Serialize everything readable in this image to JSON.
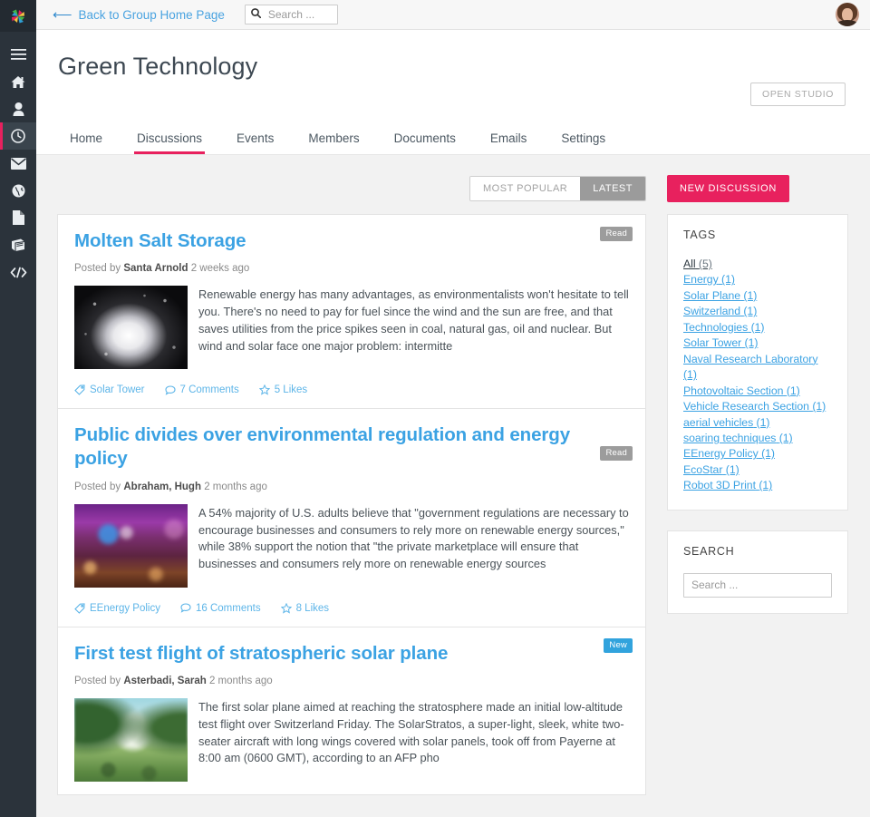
{
  "rail": {
    "logo_name": "pinwheel-logo",
    "items": [
      {
        "icon": "hamburger-menu-icon",
        "name": "menu"
      },
      {
        "icon": "home-icon",
        "name": "home"
      },
      {
        "icon": "person-icon",
        "name": "profile"
      },
      {
        "icon": "clock-icon",
        "name": "activity",
        "active": true
      },
      {
        "icon": "envelope-icon",
        "name": "messages"
      },
      {
        "icon": "globe-icon",
        "name": "network"
      },
      {
        "icon": "document-icon",
        "name": "documents"
      },
      {
        "icon": "book-icon",
        "name": "library"
      },
      {
        "icon": "code-icon",
        "name": "code"
      }
    ]
  },
  "topbar": {
    "back_label": "Back to Group Home Page",
    "search_placeholder": "Search ...",
    "search_value": ""
  },
  "header": {
    "title": "Green Technology",
    "open_studio_label": "OPEN STUDIO"
  },
  "tabs": [
    {
      "label": "Home",
      "active": false
    },
    {
      "label": "Discussions",
      "active": true
    },
    {
      "label": "Events",
      "active": false
    },
    {
      "label": "Members",
      "active": false
    },
    {
      "label": "Documents",
      "active": false
    },
    {
      "label": "Emails",
      "active": false
    },
    {
      "label": "Settings",
      "active": false
    }
  ],
  "filters": {
    "most_popular": "MOST POPULAR",
    "latest": "LATEST",
    "active": "LATEST",
    "new_discussion": "NEW DISCUSSION"
  },
  "posts": [
    {
      "title": "Molten Salt Storage",
      "badge": "Read",
      "badge_type": "read",
      "posted_by_prefix": "Posted by",
      "author": "Santa Arnold",
      "time": "2 weeks ago",
      "excerpt": "Renewable energy has many advantages, as environmentalists won't hesitate to tell you. There's no need to pay for fuel since the wind and the sun are free, and that saves utilities from the price spikes seen in coal, natural gas, oil and nuclear. But wind and solar face one major problem: intermitte",
      "tag": "Solar Tower",
      "comments": "7 Comments",
      "likes": "5 Likes",
      "thumb": "art-salt"
    },
    {
      "title": "Public divides over environmental regulation and energy policy",
      "badge": "Read",
      "badge_type": "read",
      "posted_by_prefix": "Posted by",
      "author": "Abraham, Hugh",
      "time": "2 months ago",
      "excerpt": "A 54% majority of U.S. adults believe that \"government regulations are necessary to encourage businesses and consumers to rely more on renewable energy sources,\" while 38% support the notion that \"the private marketplace will ensure that businesses and consumers rely more on renewable energy sources",
      "tag": "EEnergy Policy",
      "comments": "16 Comments",
      "likes": "8 Likes",
      "thumb": "art-gala"
    },
    {
      "title": "First test flight of stratospheric solar plane",
      "badge": "New",
      "badge_type": "new",
      "posted_by_prefix": "Posted by",
      "author": "Asterbadi, Sarah",
      "time": "2 months ago",
      "excerpt": "The first solar plane aimed at reaching the stratosphere made an initial low-altitude test flight over Switzerland Friday. The SolarStratos, a super-light, sleek, white two-seater aircraft with long wings covered with solar panels, took off from Payerne at 8:00 am (0600 GMT), according to an AFP pho",
      "tag": "",
      "comments": "",
      "likes": "",
      "thumb": "art-park"
    }
  ],
  "tags_widget": {
    "title": "TAGS",
    "items": [
      {
        "label": "All",
        "count": "(5)",
        "all": true
      },
      {
        "label": "Energy",
        "count": "(1)"
      },
      {
        "label": "Solar Plane",
        "count": "(1)"
      },
      {
        "label": "Switzerland",
        "count": "(1)"
      },
      {
        "label": "Technologies",
        "count": "(1)"
      },
      {
        "label": "Solar Tower",
        "count": "(1)"
      },
      {
        "label": "Naval Research Laboratory",
        "count": "(1)"
      },
      {
        "label": "Photovoltaic Section",
        "count": "(1)"
      },
      {
        "label": "Vehicle Research Section",
        "count": "(1)"
      },
      {
        "label": "aerial vehicles",
        "count": "(1)"
      },
      {
        "label": "soaring techniques",
        "count": "(1)"
      },
      {
        "label": "EEnergy Policy",
        "count": "(1)"
      },
      {
        "label": "EcoStar",
        "count": "(1)"
      },
      {
        "label": "Robot 3D Print",
        "count": "(1)"
      }
    ]
  },
  "search_widget": {
    "title": "SEARCH",
    "placeholder": "Search ...",
    "value": ""
  },
  "colors": {
    "accent_pink": "#e8215e",
    "link_blue": "#3ba2e3",
    "badge_new": "#31a3dd",
    "badge_read": "#9c9c9c",
    "rail_bg": "#2b333b"
  }
}
